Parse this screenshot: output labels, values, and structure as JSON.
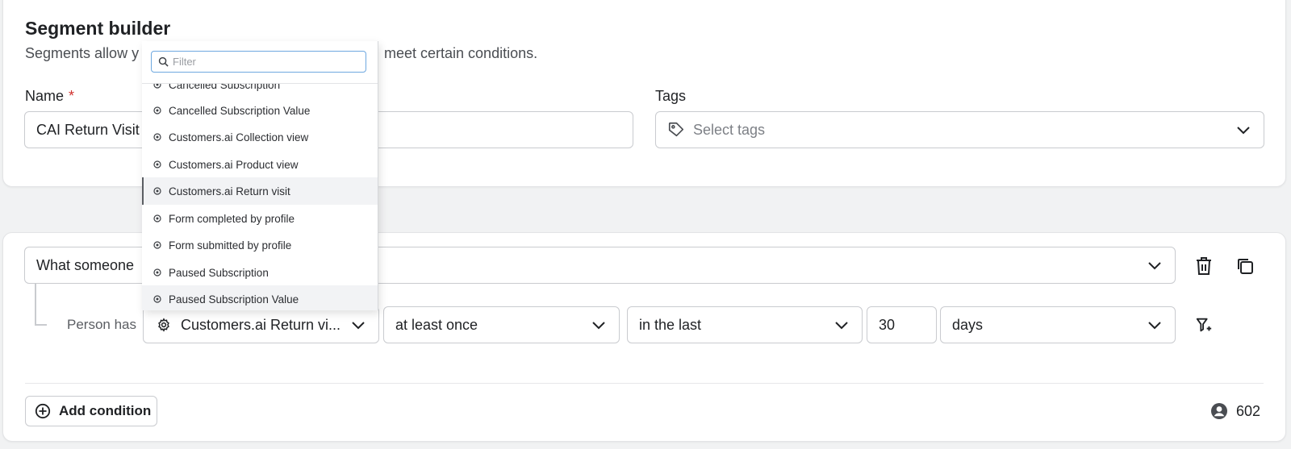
{
  "header": {
    "title": "Segment builder",
    "subtitle_start": "Segments allow y",
    "subtitle_end": "meet certain conditions."
  },
  "form": {
    "name_label": "Name",
    "required_mark": "*",
    "name_value": "CAI Return Visit",
    "tags_label": "Tags",
    "tags_placeholder": "Select tags"
  },
  "condition": {
    "type_value": "What someone",
    "person_has_label": "Person has",
    "metric_value": "Customers.ai Return vi...",
    "frequency_value": "at least once",
    "timeframe_value": "in the last",
    "amount_value": "30",
    "unit_value": "days"
  },
  "dropdown": {
    "filter_placeholder": "Filter",
    "options": [
      "Cancelled Subscription",
      "Cancelled Subscription Value",
      "Customers.ai Collection view",
      "Customers.ai Product view",
      "Customers.ai Return visit",
      "Form completed by profile",
      "Form submitted by profile",
      "Paused Subscription",
      "Paused Subscription Value"
    ],
    "selected": "Customers.ai Return visit"
  },
  "footer": {
    "add_condition_label": "Add condition",
    "profile_count": "602"
  },
  "colors": {
    "required": "#d0312d",
    "focus": "#6ea8e0",
    "border": "#c9cbcf"
  }
}
